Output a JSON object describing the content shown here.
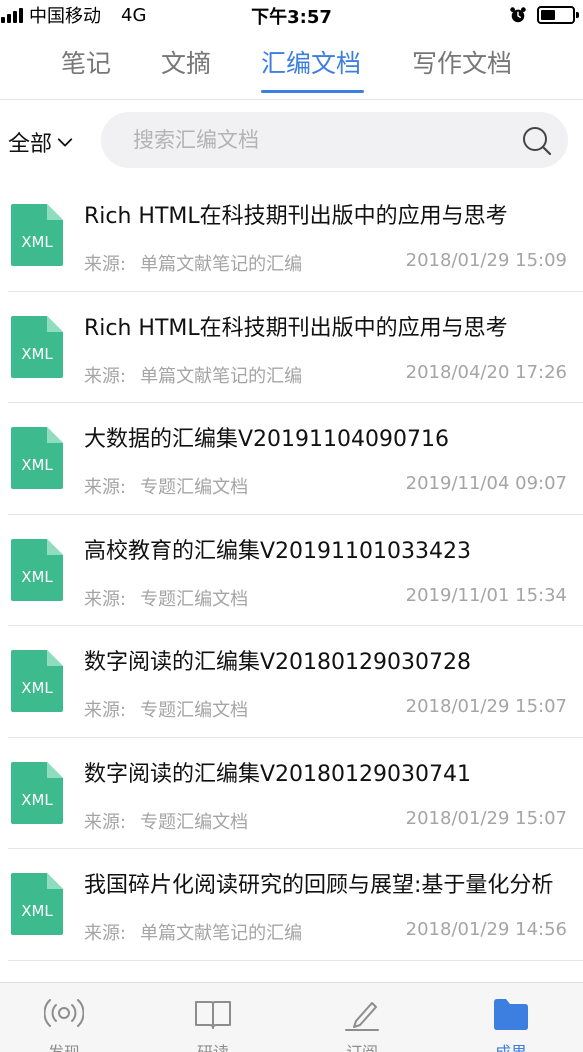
{
  "status": {
    "carrier": "中国移动",
    "network": "4G",
    "time": "下午3:57"
  },
  "tabs": [
    {
      "label": "笔记",
      "active": false
    },
    {
      "label": "文摘",
      "active": false
    },
    {
      "label": "汇编文档",
      "active": true
    },
    {
      "label": "写作文档",
      "active": false
    }
  ],
  "filter": {
    "dropdown_label": "全部",
    "search_placeholder": "搜索汇编文档"
  },
  "file_icon_label": "XML",
  "source_label": "来源:",
  "items": [
    {
      "title": "Rich HTML在科技期刊出版中的应用与思考",
      "source": "单篇文献笔记的汇编",
      "date": "2018/01/29 15:09"
    },
    {
      "title": "Rich HTML在科技期刊出版中的应用与思考",
      "source": "单篇文献笔记的汇编",
      "date": "2018/04/20 17:26"
    },
    {
      "title": "大数据的汇编集V20191104090716",
      "source": "专题汇编文档",
      "date": "2019/11/04 09:07"
    },
    {
      "title": "高校教育的汇编集V20191101033423",
      "source": "专题汇编文档",
      "date": "2019/11/01 15:34"
    },
    {
      "title": "数字阅读的汇编集V20180129030728",
      "source": "专题汇编文档",
      "date": "2018/01/29 15:07"
    },
    {
      "title": "数字阅读的汇编集V20180129030741",
      "source": "专题汇编文档",
      "date": "2018/01/29 15:07"
    },
    {
      "title": "我国碎片化阅读研究的回顾与展望:基于量化分析",
      "source": "单篇文献笔记的汇编",
      "date": "2018/01/29 14:56"
    }
  ],
  "bottom_nav": [
    {
      "label": "发现",
      "icon": "signal-waves-icon",
      "active": false
    },
    {
      "label": "研读",
      "icon": "book-icon",
      "active": false
    },
    {
      "label": "订阅",
      "icon": "pen-icon",
      "active": false
    },
    {
      "label": "成果",
      "icon": "folder-icon",
      "active": true
    }
  ],
  "colors": {
    "accent": "#3d7fe0",
    "file_icon": "#3dbb8f"
  }
}
